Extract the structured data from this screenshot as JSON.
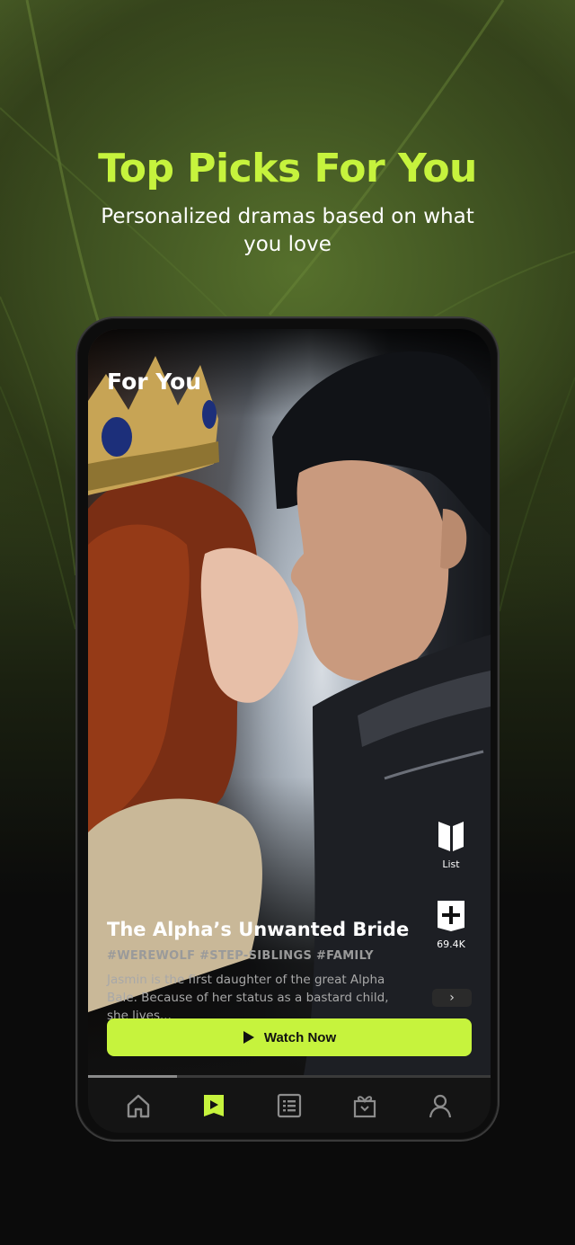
{
  "hero": {
    "title": "Top Picks For You",
    "subtitle": "Personalized dramas based on what you love"
  },
  "screen": {
    "title": "For You",
    "show": {
      "title": "The Alpha’s Unwanted Bride",
      "tags": "#WEREWOLF #STEP-SIBLINGS #FAMILY",
      "description": "Jasmin is the first daughter of the great Alpha Bale. Because of her status as a bastard child, she lives...",
      "more_glyph": "›"
    },
    "side_actions": {
      "list_label": "List",
      "add_count": "69.4K"
    },
    "watch_button": "Watch Now",
    "progress": 0.22,
    "nav": [
      {
        "name": "home",
        "icon": "home-icon",
        "active": false
      },
      {
        "name": "shorts",
        "icon": "play-flag-icon",
        "active": true
      },
      {
        "name": "list",
        "icon": "list-icon",
        "active": false
      },
      {
        "name": "rewards",
        "icon": "gift-icon",
        "active": false
      },
      {
        "name": "profile",
        "icon": "profile-icon",
        "active": false
      }
    ]
  },
  "colors": {
    "accent": "#c6f33d",
    "background": "#0b0b0b"
  }
}
